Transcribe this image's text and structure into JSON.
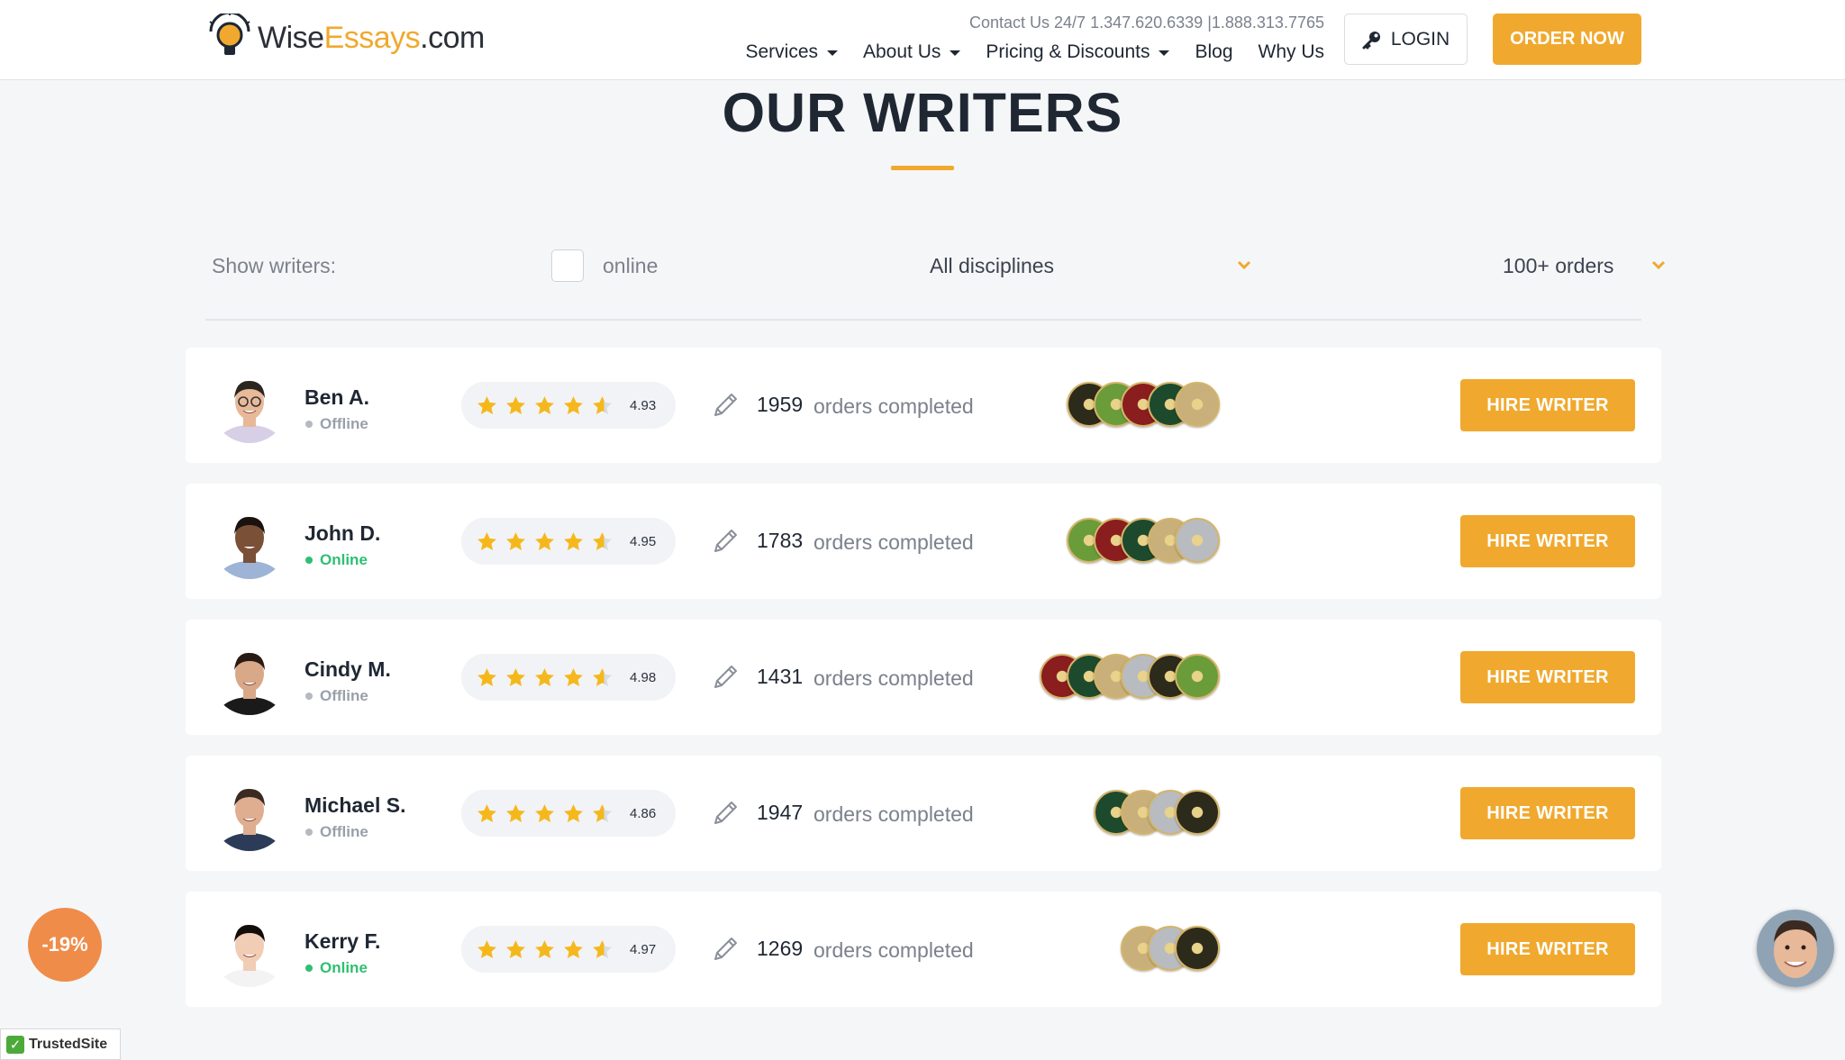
{
  "header": {
    "logo_text_part1": "Wise",
    "logo_text_part2": "Essays",
    "logo_text_part3": ".com",
    "contact": "Contact Us 24/7  1.347.620.6339 |1.888.313.7765",
    "nav": [
      {
        "label": "Services",
        "has_dropdown": true
      },
      {
        "label": "About Us",
        "has_dropdown": true
      },
      {
        "label": "Pricing & Discounts",
        "has_dropdown": true
      },
      {
        "label": "Blog",
        "has_dropdown": false
      },
      {
        "label": "Why Us",
        "has_dropdown": false
      }
    ],
    "login_label": "LOGIN",
    "login_icon": "key-icon",
    "order_label": "ORDER NOW"
  },
  "page": {
    "title": "OUR WRITERS"
  },
  "filters": {
    "show_label": "Show writers:",
    "online_label": "online",
    "online_checked": false,
    "discipline_value": "All disciplines",
    "orders_value": "100+ orders"
  },
  "writers": [
    {
      "name": "Ben A.",
      "status": "Offline",
      "rating": "4.93",
      "orders": "1959",
      "orders_label": "orders completed",
      "hire_label": "HIRE WRITER",
      "badge_count": 5
    },
    {
      "name": "John D.",
      "status": "Online",
      "rating": "4.95",
      "orders": "1783",
      "orders_label": "orders completed",
      "hire_label": "HIRE WRITER",
      "badge_count": 5
    },
    {
      "name": "Cindy M.",
      "status": "Offline",
      "rating": "4.98",
      "orders": "1431",
      "orders_label": "orders completed",
      "hire_label": "HIRE WRITER",
      "badge_count": 6
    },
    {
      "name": "Michael S.",
      "status": "Offline",
      "rating": "4.86",
      "orders": "1947",
      "orders_label": "orders completed",
      "hire_label": "HIRE WRITER",
      "badge_count": 4
    },
    {
      "name": "Kerry F.",
      "status": "Online",
      "rating": "4.97",
      "orders": "1269",
      "orders_label": "orders completed",
      "hire_label": "HIRE WRITER",
      "badge_count": 3
    }
  ],
  "floaters": {
    "discount": "-19%",
    "trusted": "TrustedSite"
  },
  "colors": {
    "accent": "#f0a92e",
    "online": "#2fbf71",
    "offline": "#9aa0aa"
  }
}
